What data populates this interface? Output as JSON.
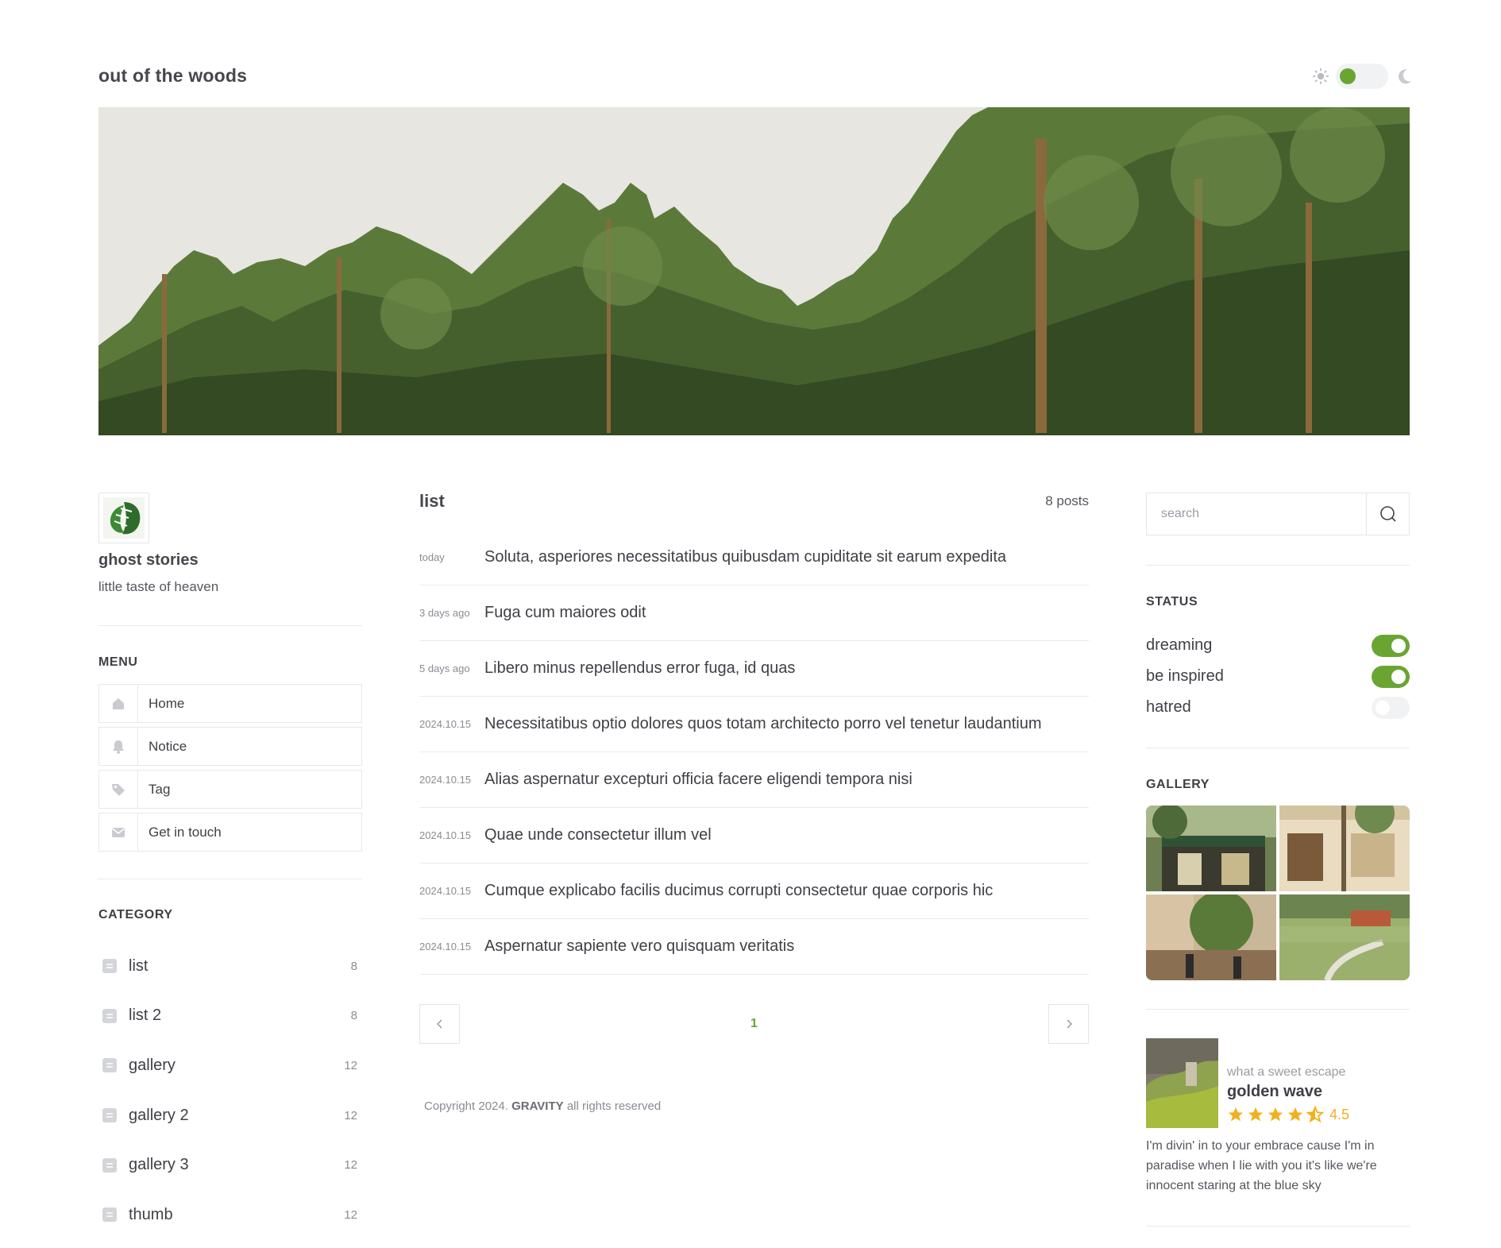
{
  "header": {
    "site_title": "out of the woods"
  },
  "hero": {
    "image": "forest-treeline"
  },
  "profile": {
    "name": "ghost stories",
    "description": "little taste of heaven"
  },
  "menu": {
    "title": "MENU",
    "items": [
      {
        "label": "Home",
        "icon": "home-icon"
      },
      {
        "label": "Notice",
        "icon": "bell-icon"
      },
      {
        "label": "Tag",
        "icon": "tag-icon"
      },
      {
        "label": "Get in touch",
        "icon": "mail-icon"
      }
    ]
  },
  "category": {
    "title": "CATEGORY",
    "items": [
      {
        "label": "list",
        "count": "8"
      },
      {
        "label": "list 2",
        "count": "8"
      },
      {
        "label": "gallery",
        "count": "12"
      },
      {
        "label": "gallery 2",
        "count": "12"
      },
      {
        "label": "gallery 3",
        "count": "12"
      },
      {
        "label": "thumb",
        "count": "12"
      }
    ]
  },
  "list": {
    "title": "list",
    "post_count": "8 posts",
    "posts": [
      {
        "date": "today",
        "title": "Soluta, asperiores necessitatibus quibusdam cupiditate sit earum expedita"
      },
      {
        "date": "3 days ago",
        "title": "Fuga cum maiores odit"
      },
      {
        "date": "5 days ago",
        "title": "Libero minus repellendus error fuga, id quas"
      },
      {
        "date": "2024.10.15",
        "title": "Necessitatibus optio dolores quos totam architecto porro vel tenetur laudantium"
      },
      {
        "date": "2024.10.15",
        "title": "Alias aspernatur excepturi officia facere eligendi tempora nisi"
      },
      {
        "date": "2024.10.15",
        "title": "Quae unde consectetur illum vel"
      },
      {
        "date": "2024.10.15",
        "title": "Cumque explicabo facilis ducimus corrupti consectetur quae corporis hic"
      },
      {
        "date": "2024.10.15",
        "title": "Aspernatur sapiente vero quisquam veritatis"
      }
    ],
    "pagination": {
      "current_page": "1"
    }
  },
  "footer": {
    "copyright_prefix": "Copyright 2024.",
    "brand": "GRAVITY",
    "copyright_suffix": "all rights reserved"
  },
  "search": {
    "placeholder": "search"
  },
  "status": {
    "title": "STATUS",
    "items": [
      {
        "label": "dreaming",
        "on": true
      },
      {
        "label": "be inspired",
        "on": true
      },
      {
        "label": "hatred",
        "on": false
      }
    ]
  },
  "gallery": {
    "title": "GALLERY"
  },
  "feature": {
    "subtitle": "what a sweet escape",
    "title": "golden wave",
    "rating": 4.5,
    "rating_text": "4.5",
    "text": "I'm divin' in to your embrace cause I'm in paradise when I lie with you it's like we're innocent staring at the blue sky"
  },
  "colors": {
    "accent": "#6aa532",
    "star": "#f2b01e",
    "text": "#3f4046",
    "muted": "#8a8c93",
    "border": "#e4e5e8"
  }
}
